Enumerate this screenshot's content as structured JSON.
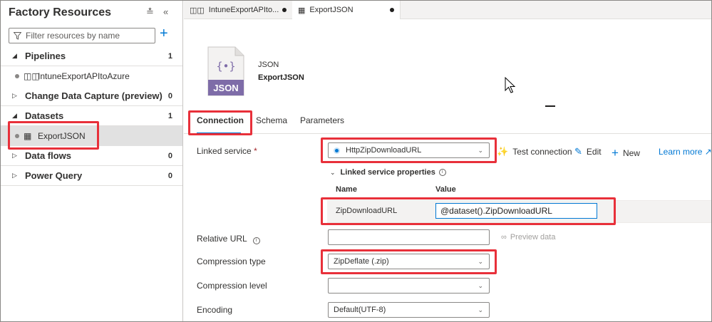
{
  "left_pane": {
    "title": "Factory Resources",
    "filter_placeholder": "Filter resources by name",
    "groups": [
      {
        "label": "Pipelines",
        "count": "1",
        "expanded": true
      },
      {
        "label": "Change Data Capture (preview)",
        "count": "0",
        "expanded": false
      },
      {
        "label": "Datasets",
        "count": "1",
        "expanded": true
      },
      {
        "label": "Data flows",
        "count": "0",
        "expanded": false
      },
      {
        "label": "Power Query",
        "count": "0",
        "expanded": false
      }
    ],
    "pipeline_item": "IntuneExportAPItoAzure",
    "dataset_item": "ExportJSON"
  },
  "tabs": [
    {
      "label": "IntuneExportAPIto...",
      "icon": "pipeline-icon"
    },
    {
      "label": "ExportJSON",
      "icon": "table-icon",
      "active": true
    }
  ],
  "dataset": {
    "icon_text": "JSON",
    "type": "JSON",
    "name": "ExportJSON"
  },
  "subtabs": [
    "Connection",
    "Schema",
    "Parameters"
  ],
  "form": {
    "linked_service_label": "Linked service",
    "required_mark": "*",
    "linked_service_value": "HttpZipDownloadURL",
    "test_connection": "Test connection",
    "edit": "Edit",
    "new": "New",
    "learn_more": "Learn more",
    "linked_service_properties": "Linked service properties",
    "col_name": "Name",
    "col_value": "Value",
    "param_name": "ZipDownloadURL",
    "param_value": "@dataset().ZipDownloadURL",
    "relative_url_label": "Relative URL",
    "relative_url_value": "",
    "preview_data": "Preview data",
    "compression_type_label": "Compression type",
    "compression_type_value": "ZipDeflate (.zip)",
    "compression_level_label": "Compression level",
    "compression_level_value": "",
    "encoding_label": "Encoding",
    "encoding_value": "Default(UTF-8)"
  },
  "colors": {
    "accent": "#0078d4",
    "highlight_box": "#e8303a",
    "selected_row": "#e1e1e1",
    "json_icon": "#7e6ca8"
  }
}
